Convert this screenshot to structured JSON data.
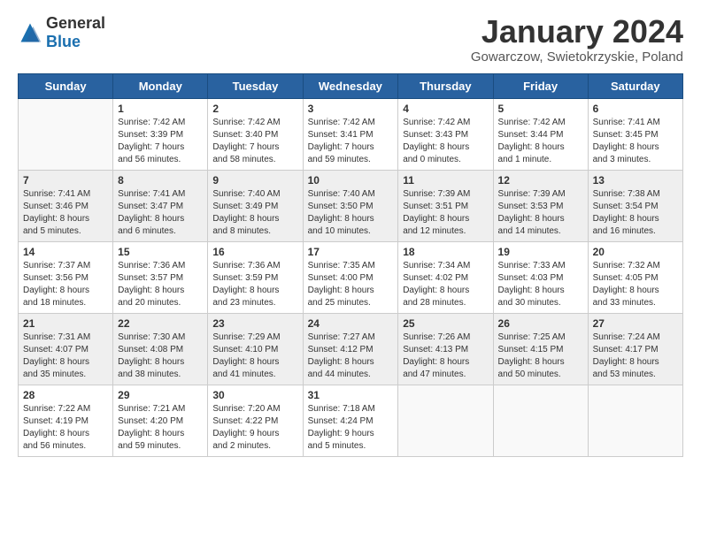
{
  "header": {
    "logo_general": "General",
    "logo_blue": "Blue",
    "month": "January 2024",
    "location": "Gowarczow, Swietokrzyskie, Poland"
  },
  "weekdays": [
    "Sunday",
    "Monday",
    "Tuesday",
    "Wednesday",
    "Thursday",
    "Friday",
    "Saturday"
  ],
  "weeks": [
    [
      {
        "day": "",
        "sunrise": "",
        "sunset": "",
        "daylight": ""
      },
      {
        "day": "1",
        "sunrise": "Sunrise: 7:42 AM",
        "sunset": "Sunset: 3:39 PM",
        "daylight": "Daylight: 7 hours and 56 minutes."
      },
      {
        "day": "2",
        "sunrise": "Sunrise: 7:42 AM",
        "sunset": "Sunset: 3:40 PM",
        "daylight": "Daylight: 7 hours and 58 minutes."
      },
      {
        "day": "3",
        "sunrise": "Sunrise: 7:42 AM",
        "sunset": "Sunset: 3:41 PM",
        "daylight": "Daylight: 7 hours and 59 minutes."
      },
      {
        "day": "4",
        "sunrise": "Sunrise: 7:42 AM",
        "sunset": "Sunset: 3:43 PM",
        "daylight": "Daylight: 8 hours and 0 minutes."
      },
      {
        "day": "5",
        "sunrise": "Sunrise: 7:42 AM",
        "sunset": "Sunset: 3:44 PM",
        "daylight": "Daylight: 8 hours and 1 minute."
      },
      {
        "day": "6",
        "sunrise": "Sunrise: 7:41 AM",
        "sunset": "Sunset: 3:45 PM",
        "daylight": "Daylight: 8 hours and 3 minutes."
      }
    ],
    [
      {
        "day": "7",
        "sunrise": "Sunrise: 7:41 AM",
        "sunset": "Sunset: 3:46 PM",
        "daylight": "Daylight: 8 hours and 5 minutes."
      },
      {
        "day": "8",
        "sunrise": "Sunrise: 7:41 AM",
        "sunset": "Sunset: 3:47 PM",
        "daylight": "Daylight: 8 hours and 6 minutes."
      },
      {
        "day": "9",
        "sunrise": "Sunrise: 7:40 AM",
        "sunset": "Sunset: 3:49 PM",
        "daylight": "Daylight: 8 hours and 8 minutes."
      },
      {
        "day": "10",
        "sunrise": "Sunrise: 7:40 AM",
        "sunset": "Sunset: 3:50 PM",
        "daylight": "Daylight: 8 hours and 10 minutes."
      },
      {
        "day": "11",
        "sunrise": "Sunrise: 7:39 AM",
        "sunset": "Sunset: 3:51 PM",
        "daylight": "Daylight: 8 hours and 12 minutes."
      },
      {
        "day": "12",
        "sunrise": "Sunrise: 7:39 AM",
        "sunset": "Sunset: 3:53 PM",
        "daylight": "Daylight: 8 hours and 14 minutes."
      },
      {
        "day": "13",
        "sunrise": "Sunrise: 7:38 AM",
        "sunset": "Sunset: 3:54 PM",
        "daylight": "Daylight: 8 hours and 16 minutes."
      }
    ],
    [
      {
        "day": "14",
        "sunrise": "Sunrise: 7:37 AM",
        "sunset": "Sunset: 3:56 PM",
        "daylight": "Daylight: 8 hours and 18 minutes."
      },
      {
        "day": "15",
        "sunrise": "Sunrise: 7:36 AM",
        "sunset": "Sunset: 3:57 PM",
        "daylight": "Daylight: 8 hours and 20 minutes."
      },
      {
        "day": "16",
        "sunrise": "Sunrise: 7:36 AM",
        "sunset": "Sunset: 3:59 PM",
        "daylight": "Daylight: 8 hours and 23 minutes."
      },
      {
        "day": "17",
        "sunrise": "Sunrise: 7:35 AM",
        "sunset": "Sunset: 4:00 PM",
        "daylight": "Daylight: 8 hours and 25 minutes."
      },
      {
        "day": "18",
        "sunrise": "Sunrise: 7:34 AM",
        "sunset": "Sunset: 4:02 PM",
        "daylight": "Daylight: 8 hours and 28 minutes."
      },
      {
        "day": "19",
        "sunrise": "Sunrise: 7:33 AM",
        "sunset": "Sunset: 4:03 PM",
        "daylight": "Daylight: 8 hours and 30 minutes."
      },
      {
        "day": "20",
        "sunrise": "Sunrise: 7:32 AM",
        "sunset": "Sunset: 4:05 PM",
        "daylight": "Daylight: 8 hours and 33 minutes."
      }
    ],
    [
      {
        "day": "21",
        "sunrise": "Sunrise: 7:31 AM",
        "sunset": "Sunset: 4:07 PM",
        "daylight": "Daylight: 8 hours and 35 minutes."
      },
      {
        "day": "22",
        "sunrise": "Sunrise: 7:30 AM",
        "sunset": "Sunset: 4:08 PM",
        "daylight": "Daylight: 8 hours and 38 minutes."
      },
      {
        "day": "23",
        "sunrise": "Sunrise: 7:29 AM",
        "sunset": "Sunset: 4:10 PM",
        "daylight": "Daylight: 8 hours and 41 minutes."
      },
      {
        "day": "24",
        "sunrise": "Sunrise: 7:27 AM",
        "sunset": "Sunset: 4:12 PM",
        "daylight": "Daylight: 8 hours and 44 minutes."
      },
      {
        "day": "25",
        "sunrise": "Sunrise: 7:26 AM",
        "sunset": "Sunset: 4:13 PM",
        "daylight": "Daylight: 8 hours and 47 minutes."
      },
      {
        "day": "26",
        "sunrise": "Sunrise: 7:25 AM",
        "sunset": "Sunset: 4:15 PM",
        "daylight": "Daylight: 8 hours and 50 minutes."
      },
      {
        "day": "27",
        "sunrise": "Sunrise: 7:24 AM",
        "sunset": "Sunset: 4:17 PM",
        "daylight": "Daylight: 8 hours and 53 minutes."
      }
    ],
    [
      {
        "day": "28",
        "sunrise": "Sunrise: 7:22 AM",
        "sunset": "Sunset: 4:19 PM",
        "daylight": "Daylight: 8 hours and 56 minutes."
      },
      {
        "day": "29",
        "sunrise": "Sunrise: 7:21 AM",
        "sunset": "Sunset: 4:20 PM",
        "daylight": "Daylight: 8 hours and 59 minutes."
      },
      {
        "day": "30",
        "sunrise": "Sunrise: 7:20 AM",
        "sunset": "Sunset: 4:22 PM",
        "daylight": "Daylight: 9 hours and 2 minutes."
      },
      {
        "day": "31",
        "sunrise": "Sunrise: 7:18 AM",
        "sunset": "Sunset: 4:24 PM",
        "daylight": "Daylight: 9 hours and 5 minutes."
      },
      {
        "day": "",
        "sunrise": "",
        "sunset": "",
        "daylight": ""
      },
      {
        "day": "",
        "sunrise": "",
        "sunset": "",
        "daylight": ""
      },
      {
        "day": "",
        "sunrise": "",
        "sunset": "",
        "daylight": ""
      }
    ]
  ]
}
